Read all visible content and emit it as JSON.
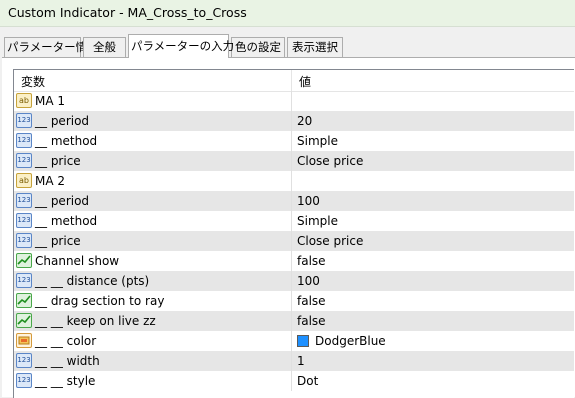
{
  "window": {
    "title": "Custom Indicator - MA_Cross_to_Cross"
  },
  "tabs": [
    {
      "label": "パラメーター情報"
    },
    {
      "label": "全般"
    },
    {
      "label": "パラメーターの入力"
    },
    {
      "label": "色の設定"
    },
    {
      "label": "表示選択"
    }
  ],
  "active_tab": "パラメーターの入力",
  "grid": {
    "col_variable": "変数",
    "col_value": "値",
    "rows": [
      {
        "type": "string",
        "icon": "string-icon",
        "name": "MA 1",
        "value": ""
      },
      {
        "type": "number",
        "icon": "number-icon",
        "name": "__ period",
        "value": "20"
      },
      {
        "type": "number",
        "icon": "number-icon",
        "name": "__ method",
        "value": "Simple"
      },
      {
        "type": "number",
        "icon": "number-icon",
        "name": "__ price",
        "value": "Close price"
      },
      {
        "type": "string",
        "icon": "string-icon",
        "name": "MA 2",
        "value": ""
      },
      {
        "type": "number",
        "icon": "number-icon",
        "name": "__ period",
        "value": "100"
      },
      {
        "type": "number",
        "icon": "number-icon",
        "name": "__ method",
        "value": "Simple"
      },
      {
        "type": "number",
        "icon": "number-icon",
        "name": "__ price",
        "value": "Close price"
      },
      {
        "type": "bool",
        "icon": "boolean-icon",
        "name": "Channel show",
        "value": "false"
      },
      {
        "type": "number",
        "icon": "number-icon",
        "name": "__ __ distance (pts)",
        "value": "100"
      },
      {
        "type": "bool",
        "icon": "boolean-icon",
        "name": "__ drag section to ray",
        "value": "false"
      },
      {
        "type": "bool",
        "icon": "boolean-icon",
        "name": "__ __ keep on live zz",
        "value": "false"
      },
      {
        "type": "color",
        "icon": "color-icon",
        "name": "__ __ color",
        "value": "DodgerBlue",
        "swatch": "#1e90ff"
      },
      {
        "type": "number",
        "icon": "number-icon",
        "name": "__ __ width",
        "value": "1"
      },
      {
        "type": "number",
        "icon": "number-icon",
        "name": "__ __ style",
        "value": "Dot"
      }
    ]
  },
  "icons": {
    "number": "123",
    "string": "ab"
  }
}
